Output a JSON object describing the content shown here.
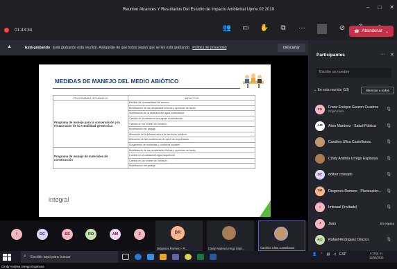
{
  "window": {
    "title": "Reunion Alcances Y Resultados Del Estudio de Impacto Ambiental Upme 02 2019"
  },
  "toolbar": {
    "elapsed": "01:43:34",
    "leave_label": "Abandonar"
  },
  "banner": {
    "bold": "Está grabando",
    "text": "Está grabando esta reunión. Asegúrate de que todos sepan que se les está grabando.",
    "link": "Política de privacidad",
    "dismiss": "Descartar"
  },
  "slide": {
    "title": "MEDIDAS DE MANEJO DEL MEDIO ABIÓTICO",
    "col1": "PROGRAMAS DE MANEJO",
    "col2": "IMPACTOS",
    "program1": "Programa de manejo para la conservación y la restauración de la estabilidad geotécnica",
    "impacts1": [
      "Pérdida de la estabilidad del terreno",
      "Modificación de las propiedades físicas y químicas del suelo",
      "Modificación de la dinámica del agua subterránea",
      "Cambio en la calidad de las aguas subterráneas",
      "Cambio en los niveles de inmisión",
      "Modificación del paisaje",
      "Alteración de la infraestructura de servicios públicos",
      "Alteración de las condiciones de salud de la población",
      "Surgimiento de molestias y conflictos sociales"
    ],
    "program2": "Programa de manejo de materiales de construcción",
    "impacts2": [
      "Modificación de las propiedades físicas y químicas del suelo",
      "Cambio en la calidad del agua superficial",
      "Cambio en los niveles de inmisión",
      "Modificación del paisaje"
    ],
    "logo": "integral"
  },
  "stage": {
    "speaker": "Cindy Andrea Urrego Espinosa"
  },
  "grid": {
    "avatars": [
      "I",
      "DC",
      "SS",
      "RO",
      "AM",
      "J"
    ],
    "tiles": [
      {
        "initials": "DR",
        "name": "Diógenes Romero - Pl..."
      },
      {
        "initials": "",
        "name": "Cindy Andrea Urrego Espi..."
      },
      {
        "initials": "",
        "name": "Carolina Ulloa Castellanos"
      }
    ]
  },
  "panel": {
    "title": "Participantes",
    "search_placeholder": "Escribe un nombre",
    "section": "En esta reunión (10)",
    "mute_all": "Silenciar a todos",
    "participants": [
      {
        "initials": "FG",
        "name": "Franz Enrique Garzon Cuadros",
        "role": "Organizador",
        "color": "#f4b6c2"
      },
      {
        "initials": "AM",
        "name": "Alvin Martinez - Salud Pública",
        "role": "",
        "color": "#ffffff"
      },
      {
        "initials": "",
        "name": "Carolina Ulloa Castellanos",
        "role": "",
        "color": "#c09a6b"
      },
      {
        "initials": "",
        "name": "Cindy Andrea Urrego Espinosa",
        "role": "",
        "color": "#a77c52"
      },
      {
        "initials": "DC",
        "name": "dolber conrado",
        "role": "",
        "color": "#d9d9f7"
      },
      {
        "initials": "DR",
        "name": "Diogenes Romero - Planeación...",
        "role": "",
        "color": "#f5b78e"
      },
      {
        "initials": "I",
        "name": "Imtrasol (Invitado)",
        "role": "",
        "color": "#f4b6c2"
      },
      {
        "initials": "J",
        "name": "Juan",
        "role": "",
        "color": "#f4b6c2",
        "status": "En espera"
      },
      {
        "initials": "RO",
        "name": "Rafael Rodriguez Orozco",
        "role": "",
        "color": "#c9e4b4"
      }
    ]
  },
  "taskbar": {
    "search_placeholder": "Escribir aquí para buscar",
    "lang": "ESP",
    "time": "4:19 p. m.",
    "date": "12/05/2021"
  }
}
